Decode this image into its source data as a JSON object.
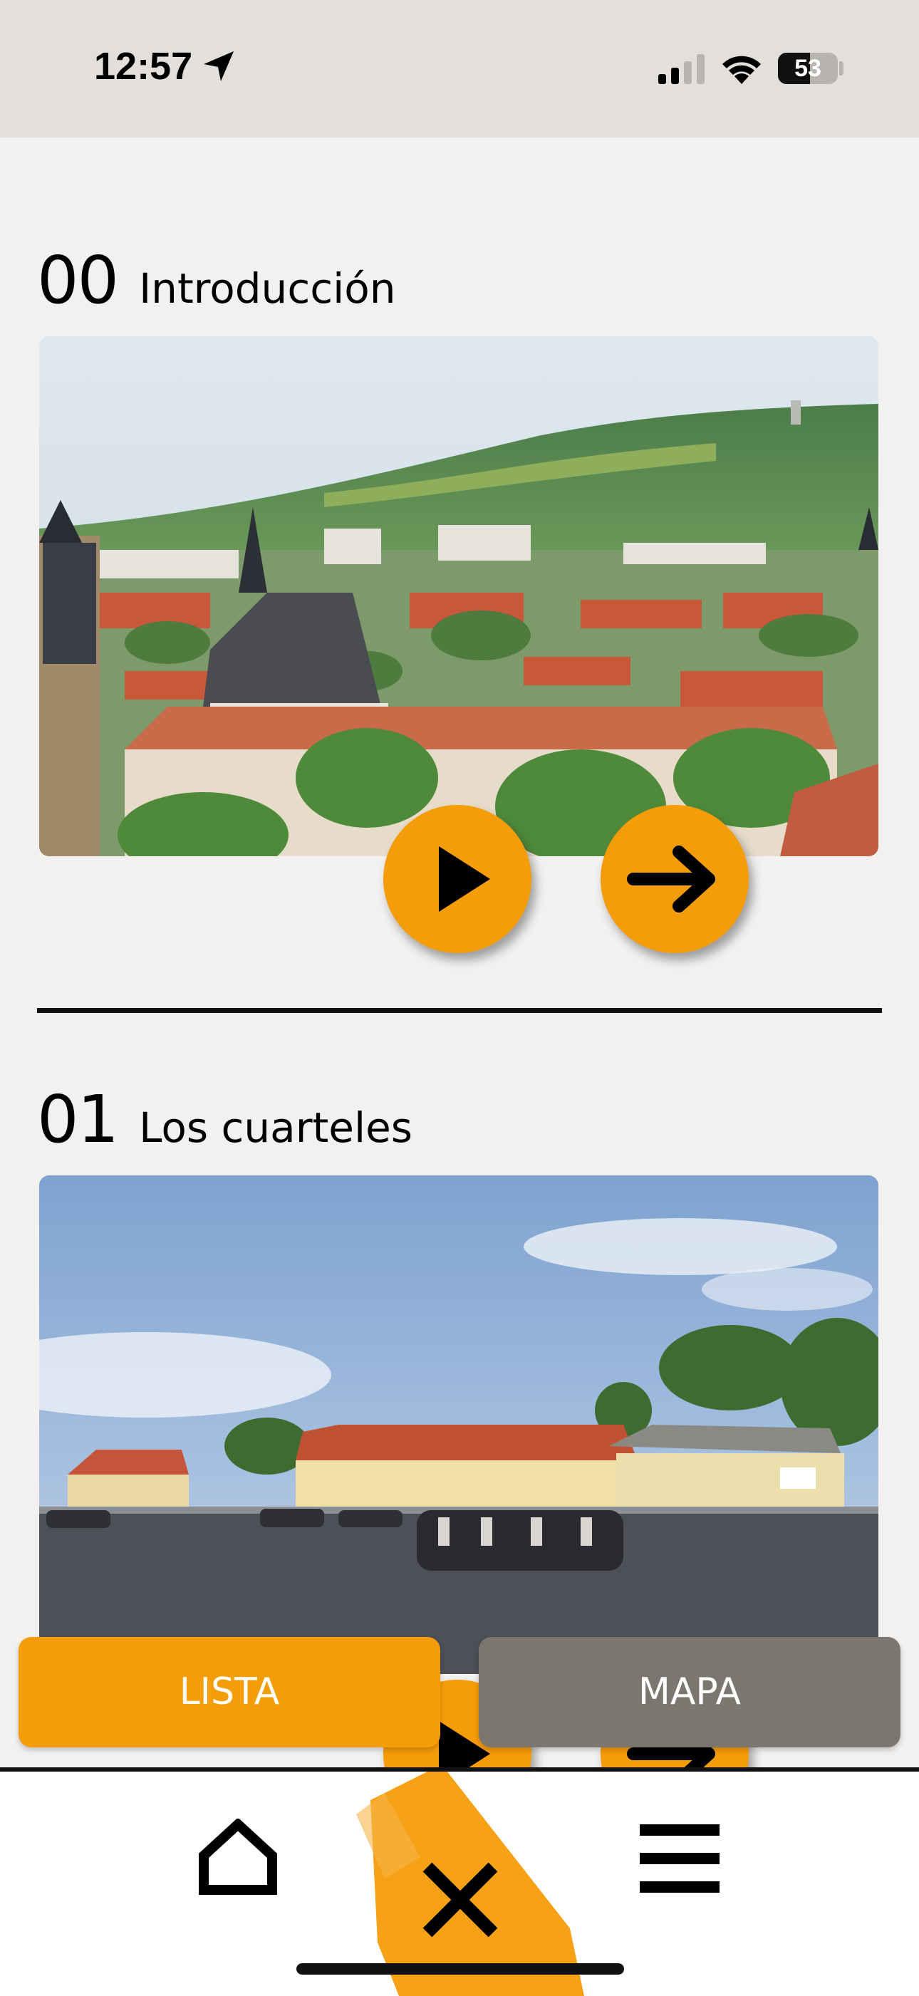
{
  "status_bar": {
    "time": "12:57",
    "battery_level": "53",
    "icons": [
      "location-arrow-icon",
      "cellular-signal-icon",
      "wifi-icon",
      "battery-icon"
    ]
  },
  "sections": [
    {
      "number": "00",
      "title": "Introducción",
      "buttons": [
        "play-icon",
        "arrow-right-icon"
      ]
    },
    {
      "number": "01",
      "title": "Los cuarteles",
      "buttons": [
        "play-icon",
        "arrow-right-icon"
      ]
    }
  ],
  "view_toggle": {
    "list_label": "LISTA",
    "map_label": "MAPA"
  },
  "tab_bar": {
    "items": [
      "home-icon",
      "close-icon",
      "menu-icon"
    ]
  },
  "colors": {
    "accent": "#f59c09",
    "secondary": "#7b7770",
    "background": "#f2f1ef",
    "status_bar": "#e3dfdb"
  }
}
